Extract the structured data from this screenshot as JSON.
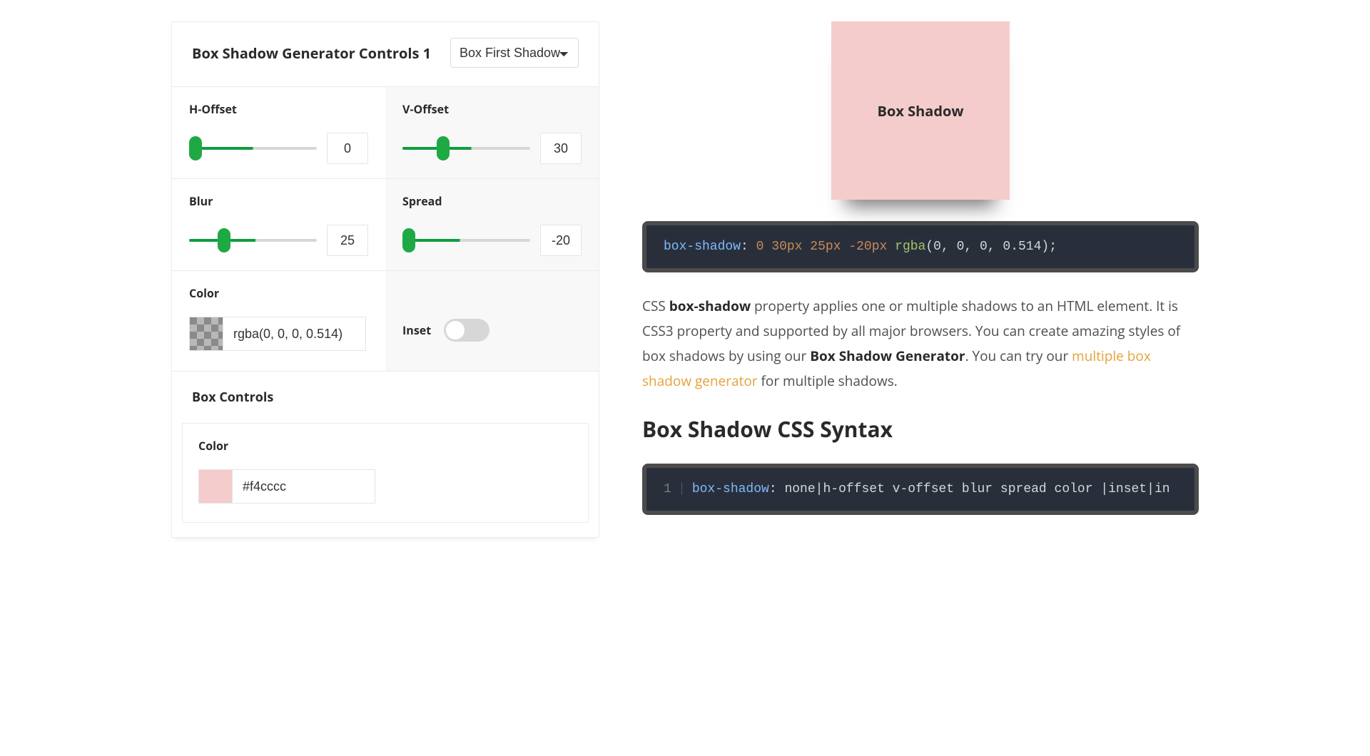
{
  "controls": {
    "title": "Box Shadow Generator Controls 1",
    "shadow_select": {
      "selected": "Box First Shadow",
      "options": [
        "Box First Shadow"
      ]
    },
    "h_offset": {
      "label": "H-Offset",
      "value": 0,
      "min": -100,
      "max": 100
    },
    "v_offset": {
      "label": "V-Offset",
      "value": 30,
      "min": -100,
      "max": 100
    },
    "blur": {
      "label": "Blur",
      "value": 25,
      "min": 0,
      "max": 100
    },
    "spread": {
      "label": "Spread",
      "value": -20,
      "min": -100,
      "max": 100
    },
    "color": {
      "label": "Color",
      "value": "rgba(0, 0, 0, 0.514)"
    },
    "inset": {
      "label": "Inset",
      "value": false
    }
  },
  "box_controls": {
    "title": "Box Controls",
    "color": {
      "label": "Color",
      "value": "#f4cccc"
    }
  },
  "preview": {
    "label": "Box Shadow",
    "bg": "#f4cccc",
    "shadow_css": "0 30px 25px -20px rgba(0, 0, 0, 0.514)"
  },
  "code1": {
    "prop": "box-shadow",
    "v1": "0",
    "v2": "30px",
    "v3": "25px",
    "v4": "-20px",
    "func": "rgba",
    "args": "(0, 0, 0, 0.514)",
    "tail": ";"
  },
  "desc": {
    "p1a": "CSS ",
    "p1b": "box-shadow",
    "p1c": " property applies one or multiple shadows to an HTML element. It is CSS3 property and supported by all major browsers. You can create amazing styles of box shadows by using our ",
    "p1d": "Box Shadow Generator",
    "p1e": ". You can try our ",
    "link_text": "multiple box shadow generator",
    "p1f": " for multiple shadows."
  },
  "syntax": {
    "title": "Box Shadow CSS Syntax",
    "line_num": "1",
    "prop": "box-shadow",
    "body": " none|h-offset v-offset blur spread color |inset|in"
  }
}
